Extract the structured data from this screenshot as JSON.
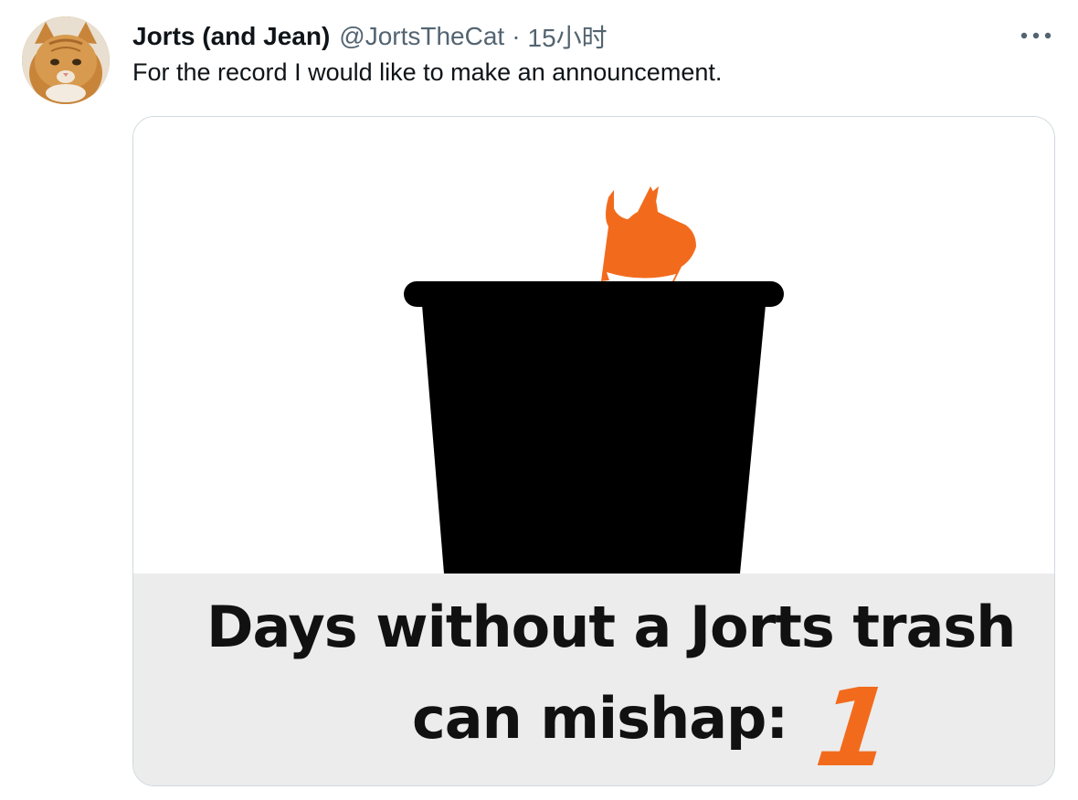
{
  "tweet": {
    "author": {
      "display_name": "Jorts (and Jean)",
      "handle": "@JortsTheCat",
      "avatar_icon": "orange-cat-avatar"
    },
    "separator": "·",
    "timestamp": "15小时",
    "more_icon": "more-horizontal-icon",
    "text": "For the record I would like to make an announcement."
  },
  "media": {
    "caption_line_1": "Days without a Jorts trash",
    "caption_line_2": "can mishap:",
    "counter_value": "1",
    "colors": {
      "cat": "#f26b1d",
      "trash_can": "#000000",
      "caption_background": "#ececec"
    }
  }
}
